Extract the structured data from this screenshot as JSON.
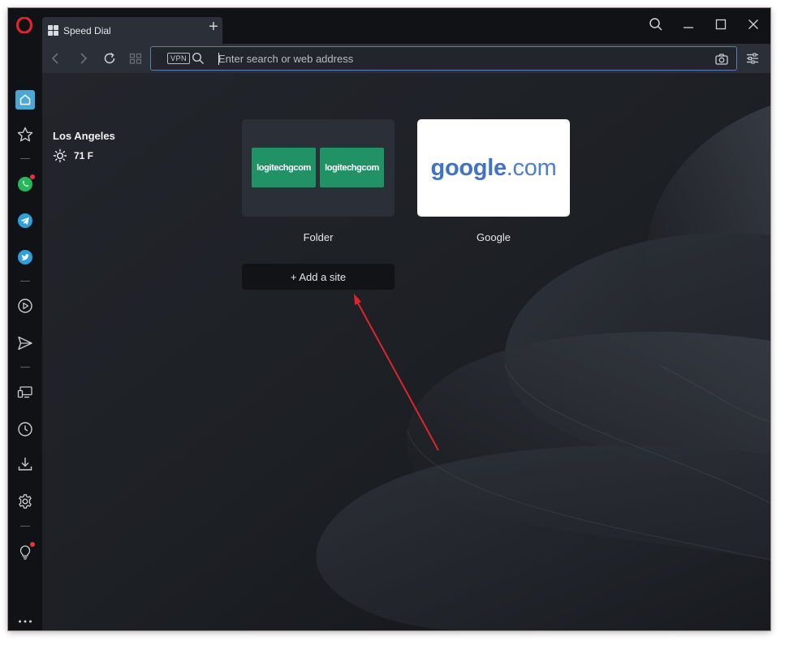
{
  "tab": {
    "title": "Speed Dial",
    "new_tab_label": "+"
  },
  "toolbar": {
    "vpn_label": "VPN",
    "address_placeholder": "Enter search or web address",
    "address_value": ""
  },
  "sidebar": {
    "items": [
      {
        "name": "home",
        "icon": "home-icon"
      },
      {
        "name": "bookmarks",
        "icon": "star-icon"
      },
      {
        "name": "whatsapp",
        "icon": "whatsapp-icon",
        "notification": true
      },
      {
        "name": "telegram",
        "icon": "telegram-icon"
      },
      {
        "name": "twitter",
        "icon": "twitter-icon"
      },
      {
        "name": "player",
        "icon": "play-icon"
      },
      {
        "name": "my-flow",
        "icon": "send-icon"
      },
      {
        "name": "tabs-sync",
        "icon": "devices-icon"
      },
      {
        "name": "history",
        "icon": "clock-icon"
      },
      {
        "name": "downloads",
        "icon": "download-icon"
      },
      {
        "name": "settings",
        "icon": "gear-icon"
      },
      {
        "name": "tips",
        "icon": "lightbulb-icon",
        "notification": true
      },
      {
        "name": "more",
        "icon": "more-icon"
      }
    ]
  },
  "weather": {
    "city": "Los Angeles",
    "temperature": "71 F",
    "condition_icon": "sun-icon"
  },
  "speed_dial": {
    "folder": {
      "label": "Folder",
      "items": [
        "logitechgcom",
        "logitechgcom"
      ]
    },
    "google": {
      "label": "Google",
      "domain_main": "google",
      "domain_tld": ".com"
    },
    "add_site_label": "+ Add a site"
  },
  "colors": {
    "accent": "#5b7fb8",
    "folder_tile_green": "#219266",
    "notification_red": "#e8333a",
    "annotation_arrow": "#e0242c",
    "opera_red": "#e0242c"
  }
}
